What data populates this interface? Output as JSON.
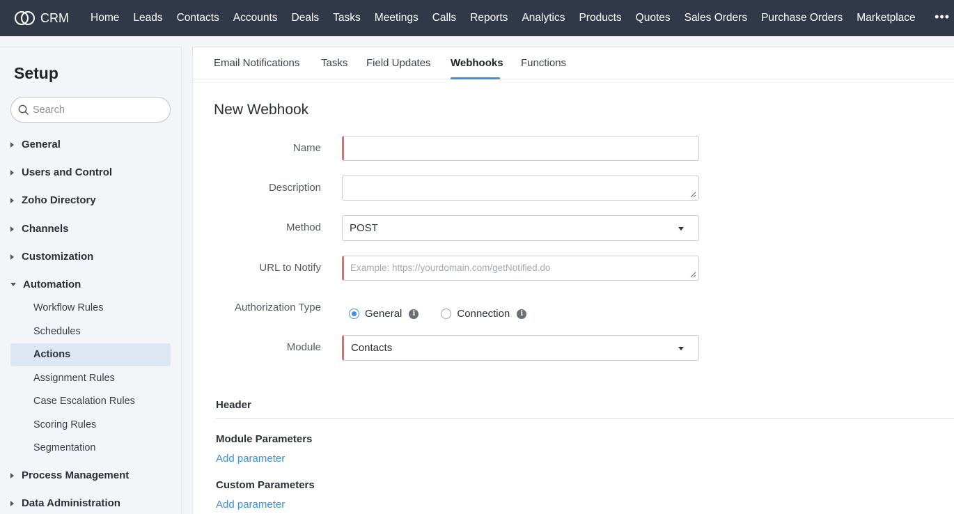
{
  "brand": {
    "name": "CRM"
  },
  "topnav": {
    "items": [
      "Home",
      "Leads",
      "Contacts",
      "Accounts",
      "Deals",
      "Tasks",
      "Meetings",
      "Calls",
      "Reports",
      "Analytics",
      "Products",
      "Quotes",
      "Sales Orders",
      "Purchase Orders",
      "Marketplace"
    ],
    "more": "•••"
  },
  "sidebar": {
    "title": "Setup",
    "search_placeholder": "Search",
    "sections": [
      "General",
      "Users and Control",
      "Zoho Directory",
      "Channels",
      "Customization",
      "Automation",
      "Process Management",
      "Data Administration"
    ],
    "automation_items": [
      "Workflow Rules",
      "Schedules",
      "Actions",
      "Assignment Rules",
      "Case Escalation Rules",
      "Scoring Rules",
      "Segmentation"
    ],
    "active_item": "Actions"
  },
  "tabs": [
    "Email Notifications",
    "Tasks",
    "Field Updates",
    "Webhooks",
    "Functions"
  ],
  "active_tab": "Webhooks",
  "form": {
    "title": "New Webhook",
    "name_label": "Name",
    "name_value": "",
    "description_label": "Description",
    "description_value": "",
    "method_label": "Method",
    "method_value": "POST",
    "url_label": "URL to Notify",
    "url_placeholder": "Example: https://yourdomain.com/getNotified.do",
    "auth_label": "Authorization Type",
    "auth_options": [
      "General",
      "Connection"
    ],
    "auth_selected": "General",
    "module_label": "Module",
    "module_value": "Contacts"
  },
  "header_section": {
    "title": "Header",
    "module_params_title": "Module Parameters",
    "module_params_link": "Add parameter",
    "custom_params_title": "Custom Parameters",
    "custom_params_link": "Add parameter"
  },
  "colors": {
    "topbar": "#313949",
    "accent": "#3a8ee6",
    "required": "#e36c6c",
    "active_bg": "#dde7f4"
  }
}
